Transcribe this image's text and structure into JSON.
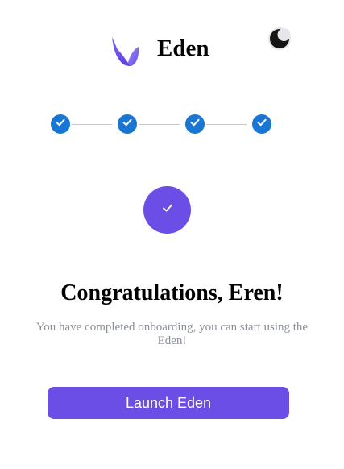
{
  "header": {
    "brand_name": "Eden",
    "logo_icon": "eden-logo-icon",
    "theme_toggle_icon": "moon-icon"
  },
  "stepper": {
    "total_steps": 4,
    "completed_steps": 4,
    "step_icon": "check-icon"
  },
  "main": {
    "success_icon": "check-icon",
    "title": "Congratulations, Eren!",
    "subtitle": "You have completed onboarding, you can start using the Eden!",
    "launch_button_label": "Launch Eden"
  },
  "colors": {
    "brand_purple": "#6a4ee6",
    "step_blue": "#1976d2",
    "connector_gray": "#c8c8c8",
    "subtitle_gray": "#8a8f98"
  }
}
